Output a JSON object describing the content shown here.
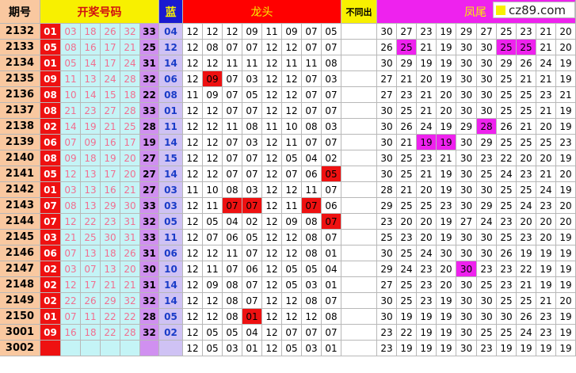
{
  "headers": {
    "issue": "期号",
    "winning": "开奖号码",
    "blue": "蓝",
    "dragon": "龙头",
    "notsame": "不同出",
    "tail": "凤尾"
  },
  "logo": {
    "text": "cz89.com",
    "square_color": "#f8f000"
  },
  "colors": {
    "header_yellow": "#f8f000",
    "header_red": "#ff0000",
    "header_magenta": "#ee22ee",
    "issue_bg": "#f9c8a0",
    "red_ball": "#ee1111",
    "cyan_ball": "#c4f4f6",
    "blue_purple": "#d090f0",
    "lavender": "#cfc2f4"
  },
  "rows": [
    {
      "issue": "2132",
      "w": [
        "01",
        "03",
        "18",
        "26",
        "32",
        "33"
      ],
      "blue": "04",
      "d": [
        "12",
        "12",
        "12",
        "09",
        "11",
        "09",
        "07",
        "05"
      ],
      "t": [
        "30",
        "27",
        "23",
        "19",
        "29",
        "27",
        "25",
        "23",
        "21",
        "20"
      ],
      "dh": [],
      "th": []
    },
    {
      "issue": "2133",
      "w": [
        "05",
        "08",
        "16",
        "17",
        "21",
        "25"
      ],
      "blue": "12",
      "d": [
        "12",
        "08",
        "07",
        "07",
        "12",
        "12",
        "07",
        "07"
      ],
      "t": [
        "26",
        "25",
        "21",
        "19",
        "30",
        "30",
        "25",
        "25",
        "21",
        "20"
      ],
      "dh": [],
      "th": [
        1,
        6,
        7
      ]
    },
    {
      "issue": "2134",
      "w": [
        "01",
        "05",
        "14",
        "17",
        "24",
        "31"
      ],
      "blue": "14",
      "d": [
        "12",
        "12",
        "11",
        "11",
        "12",
        "11",
        "11",
        "08"
      ],
      "t": [
        "30",
        "29",
        "19",
        "19",
        "30",
        "30",
        "29",
        "26",
        "24",
        "19"
      ],
      "dh": [],
      "th": []
    },
    {
      "issue": "2135",
      "w": [
        "09",
        "11",
        "13",
        "24",
        "28",
        "32"
      ],
      "blue": "06",
      "d": [
        "12",
        "09",
        "07",
        "03",
        "12",
        "12",
        "07",
        "03"
      ],
      "t": [
        "27",
        "21",
        "20",
        "19",
        "30",
        "30",
        "25",
        "21",
        "21",
        "19"
      ],
      "dh": [
        1
      ],
      "th": []
    },
    {
      "issue": "2136",
      "w": [
        "08",
        "10",
        "14",
        "15",
        "18",
        "22"
      ],
      "blue": "08",
      "d": [
        "11",
        "09",
        "07",
        "05",
        "12",
        "12",
        "07",
        "07"
      ],
      "t": [
        "27",
        "23",
        "21",
        "20",
        "30",
        "30",
        "25",
        "25",
        "23",
        "21"
      ],
      "dh": [],
      "th": []
    },
    {
      "issue": "2137",
      "w": [
        "08",
        "21",
        "23",
        "27",
        "28",
        "33"
      ],
      "blue": "01",
      "d": [
        "12",
        "12",
        "07",
        "07",
        "12",
        "12",
        "07",
        "07"
      ],
      "t": [
        "30",
        "25",
        "21",
        "20",
        "30",
        "30",
        "25",
        "25",
        "21",
        "19"
      ],
      "dh": [],
      "th": []
    },
    {
      "issue": "2138",
      "w": [
        "02",
        "14",
        "19",
        "21",
        "25",
        "28"
      ],
      "blue": "11",
      "d": [
        "12",
        "12",
        "11",
        "08",
        "11",
        "10",
        "08",
        "03"
      ],
      "t": [
        "30",
        "26",
        "24",
        "19",
        "29",
        "28",
        "26",
        "21",
        "20",
        "19"
      ],
      "dh": [],
      "th": [
        5
      ]
    },
    {
      "issue": "2139",
      "w": [
        "06",
        "07",
        "09",
        "16",
        "17",
        "19"
      ],
      "blue": "14",
      "d": [
        "12",
        "12",
        "07",
        "03",
        "12",
        "11",
        "07",
        "07"
      ],
      "t": [
        "30",
        "21",
        "19",
        "19",
        "30",
        "29",
        "25",
        "25",
        "25",
        "23"
      ],
      "dh": [],
      "th": [
        2,
        3
      ]
    },
    {
      "issue": "2140",
      "w": [
        "08",
        "09",
        "18",
        "19",
        "20",
        "27"
      ],
      "blue": "15",
      "d": [
        "12",
        "12",
        "07",
        "07",
        "12",
        "05",
        "04",
        "02"
      ],
      "t": [
        "30",
        "25",
        "23",
        "21",
        "30",
        "23",
        "22",
        "20",
        "20",
        "19"
      ],
      "dh": [],
      "th": []
    },
    {
      "issue": "2141",
      "w": [
        "05",
        "12",
        "13",
        "17",
        "20",
        "27"
      ],
      "blue": "14",
      "d": [
        "12",
        "12",
        "07",
        "07",
        "12",
        "07",
        "06",
        "05"
      ],
      "t": [
        "30",
        "25",
        "21",
        "19",
        "30",
        "25",
        "24",
        "23",
        "21",
        "20"
      ],
      "dh": [
        7
      ],
      "th": []
    },
    {
      "issue": "2142",
      "w": [
        "01",
        "03",
        "13",
        "16",
        "21",
        "27"
      ],
      "blue": "03",
      "d": [
        "11",
        "10",
        "08",
        "03",
        "12",
        "12",
        "11",
        "07"
      ],
      "t": [
        "28",
        "21",
        "20",
        "19",
        "30",
        "30",
        "25",
        "25",
        "24",
        "19"
      ],
      "dh": [],
      "th": []
    },
    {
      "issue": "2143",
      "w": [
        "07",
        "08",
        "13",
        "29",
        "30",
        "33"
      ],
      "blue": "03",
      "d": [
        "12",
        "11",
        "07",
        "07",
        "12",
        "11",
        "07",
        "06"
      ],
      "t": [
        "29",
        "25",
        "25",
        "23",
        "30",
        "29",
        "25",
        "24",
        "23",
        "20"
      ],
      "dh": [
        2,
        3,
        6
      ],
      "th": []
    },
    {
      "issue": "2144",
      "w": [
        "07",
        "12",
        "22",
        "23",
        "31",
        "32"
      ],
      "blue": "05",
      "d": [
        "12",
        "05",
        "04",
        "02",
        "12",
        "09",
        "08",
        "07"
      ],
      "t": [
        "23",
        "20",
        "20",
        "19",
        "27",
        "24",
        "23",
        "20",
        "20",
        "20"
      ],
      "dh": [
        7
      ],
      "th": []
    },
    {
      "issue": "2145",
      "w": [
        "03",
        "21",
        "25",
        "30",
        "31",
        "33"
      ],
      "blue": "11",
      "d": [
        "12",
        "07",
        "06",
        "05",
        "12",
        "12",
        "08",
        "07"
      ],
      "t": [
        "25",
        "23",
        "20",
        "19",
        "30",
        "30",
        "25",
        "23",
        "20",
        "19"
      ],
      "dh": [],
      "th": []
    },
    {
      "issue": "2146",
      "w": [
        "06",
        "07",
        "13",
        "18",
        "26",
        "31"
      ],
      "blue": "06",
      "d": [
        "12",
        "12",
        "11",
        "07",
        "12",
        "12",
        "08",
        "01"
      ],
      "t": [
        "30",
        "25",
        "24",
        "30",
        "30",
        "30",
        "26",
        "19",
        "19",
        "19"
      ],
      "dh": [],
      "th": []
    },
    {
      "issue": "2147",
      "w": [
        "02",
        "03",
        "07",
        "13",
        "20",
        "30"
      ],
      "blue": "10",
      "d": [
        "12",
        "11",
        "07",
        "06",
        "12",
        "05",
        "05",
        "04"
      ],
      "t": [
        "29",
        "24",
        "23",
        "20",
        "30",
        "23",
        "23",
        "22",
        "19",
        "19"
      ],
      "dh": [],
      "th": [
        4
      ]
    },
    {
      "issue": "2148",
      "w": [
        "02",
        "12",
        "17",
        "21",
        "21",
        "31"
      ],
      "blue": "14",
      "d": [
        "12",
        "09",
        "08",
        "07",
        "12",
        "05",
        "03",
        "01"
      ],
      "t": [
        "27",
        "25",
        "23",
        "20",
        "30",
        "25",
        "23",
        "21",
        "19",
        "19"
      ],
      "dh": [],
      "th": []
    },
    {
      "issue": "2149",
      "w": [
        "02",
        "22",
        "26",
        "29",
        "32",
        "32"
      ],
      "blue": "14",
      "d": [
        "12",
        "12",
        "08",
        "07",
        "12",
        "12",
        "08",
        "07"
      ],
      "t": [
        "30",
        "25",
        "23",
        "19",
        "30",
        "30",
        "25",
        "25",
        "21",
        "20"
      ],
      "dh": [],
      "th": []
    },
    {
      "issue": "2150",
      "w": [
        "01",
        "07",
        "11",
        "22",
        "22",
        "28"
      ],
      "blue": "05",
      "d": [
        "12",
        "12",
        "08",
        "01",
        "12",
        "12",
        "12",
        "08"
      ],
      "t": [
        "30",
        "19",
        "19",
        "19",
        "30",
        "30",
        "30",
        "26",
        "23",
        "19"
      ],
      "dh": [
        3
      ],
      "th": []
    },
    {
      "issue": "3001",
      "w": [
        "09",
        "16",
        "18",
        "22",
        "28",
        "32"
      ],
      "blue": "02",
      "d": [
        "12",
        "05",
        "05",
        "04",
        "12",
        "07",
        "07",
        "07"
      ],
      "t": [
        "23",
        "22",
        "19",
        "19",
        "30",
        "25",
        "25",
        "24",
        "23",
        "19"
      ],
      "dh": [],
      "th": []
    },
    {
      "issue": "3002",
      "w": [
        "",
        "",
        "",
        "",
        "",
        ""
      ],
      "blue": "",
      "d": [
        "12",
        "05",
        "03",
        "01",
        "12",
        "05",
        "03",
        "01"
      ],
      "t": [
        "23",
        "19",
        "19",
        "19",
        "30",
        "23",
        "19",
        "19",
        "19",
        "19"
      ],
      "dh": [],
      "th": []
    }
  ]
}
